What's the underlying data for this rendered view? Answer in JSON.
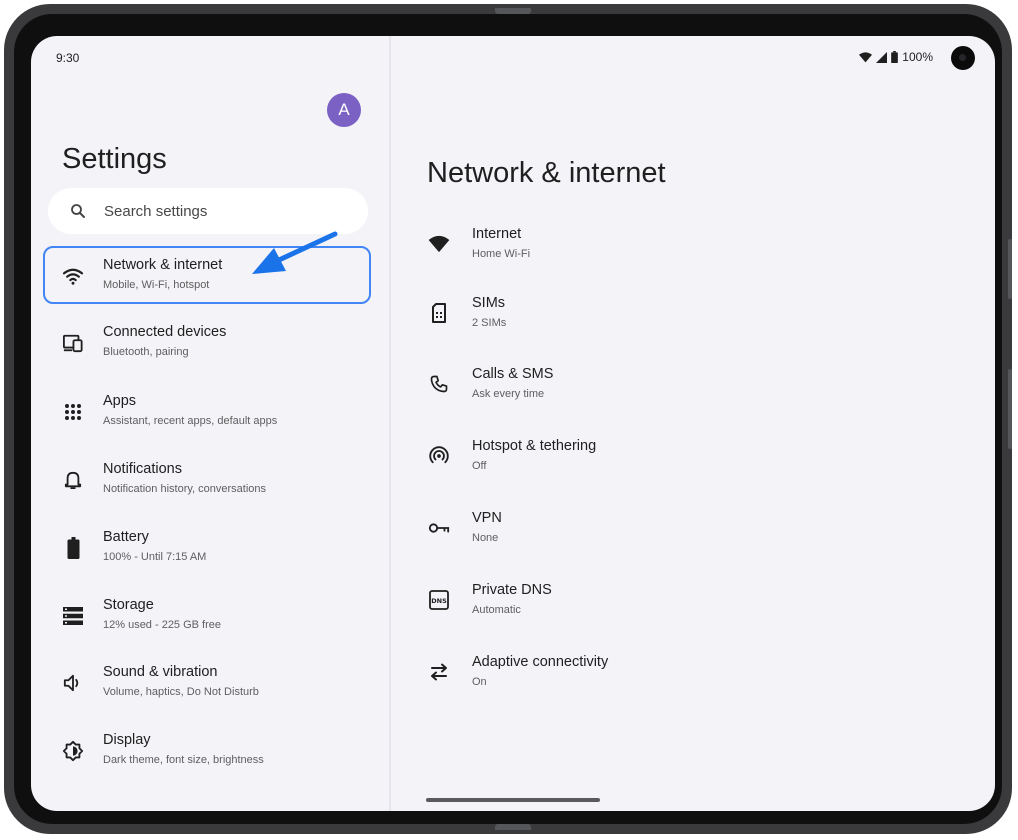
{
  "status_bar": {
    "time": "9:30",
    "battery": "100%"
  },
  "avatar": {
    "initial": "A"
  },
  "settings": {
    "title": "Settings",
    "search_placeholder": "Search settings",
    "items": [
      {
        "title": "Network & internet",
        "subtitle": "Mobile, Wi-Fi, hotspot",
        "icon": "wifi-icon",
        "selected": true
      },
      {
        "title": "Connected devices",
        "subtitle": "Bluetooth, pairing",
        "icon": "connected-devices-icon"
      },
      {
        "title": "Apps",
        "subtitle": "Assistant, recent apps, default apps",
        "icon": "apps-grid-icon"
      },
      {
        "title": "Notifications",
        "subtitle": "Notification history, conversations",
        "icon": "bell-icon"
      },
      {
        "title": "Battery",
        "subtitle": "100% - Until 7:15 AM",
        "icon": "battery-icon"
      },
      {
        "title": "Storage",
        "subtitle": "12% used - 225 GB free",
        "icon": "storage-icon"
      },
      {
        "title": "Sound & vibration",
        "subtitle": "Volume, haptics, Do Not Disturb",
        "icon": "speaker-icon"
      },
      {
        "title": "Display",
        "subtitle": "Dark theme, font size, brightness",
        "icon": "display-brightness-icon"
      }
    ]
  },
  "detail": {
    "title": "Network & internet",
    "items": [
      {
        "title": "Internet",
        "subtitle": "Home Wi-Fi",
        "icon": "wifi-icon"
      },
      {
        "title": "SIMs",
        "subtitle": "2 SIMs",
        "icon": "sim-card-icon"
      },
      {
        "title": "Calls & SMS",
        "subtitle": "Ask every time",
        "icon": "phone-icon"
      },
      {
        "title": "Hotspot & tethering",
        "subtitle": "Off",
        "icon": "hotspot-icon"
      },
      {
        "title": "VPN",
        "subtitle": "None",
        "icon": "vpn-key-icon"
      },
      {
        "title": "Private DNS",
        "subtitle": "Automatic",
        "icon": "dns-icon"
      },
      {
        "title": "Adaptive connectivity",
        "subtitle": "On",
        "icon": "swap-arrows-icon"
      }
    ]
  },
  "colors": {
    "accent": "#4285f4",
    "arrow": "#1a73e8",
    "avatar": "#7b61c4",
    "screen_bg": "#f3f3f8"
  }
}
